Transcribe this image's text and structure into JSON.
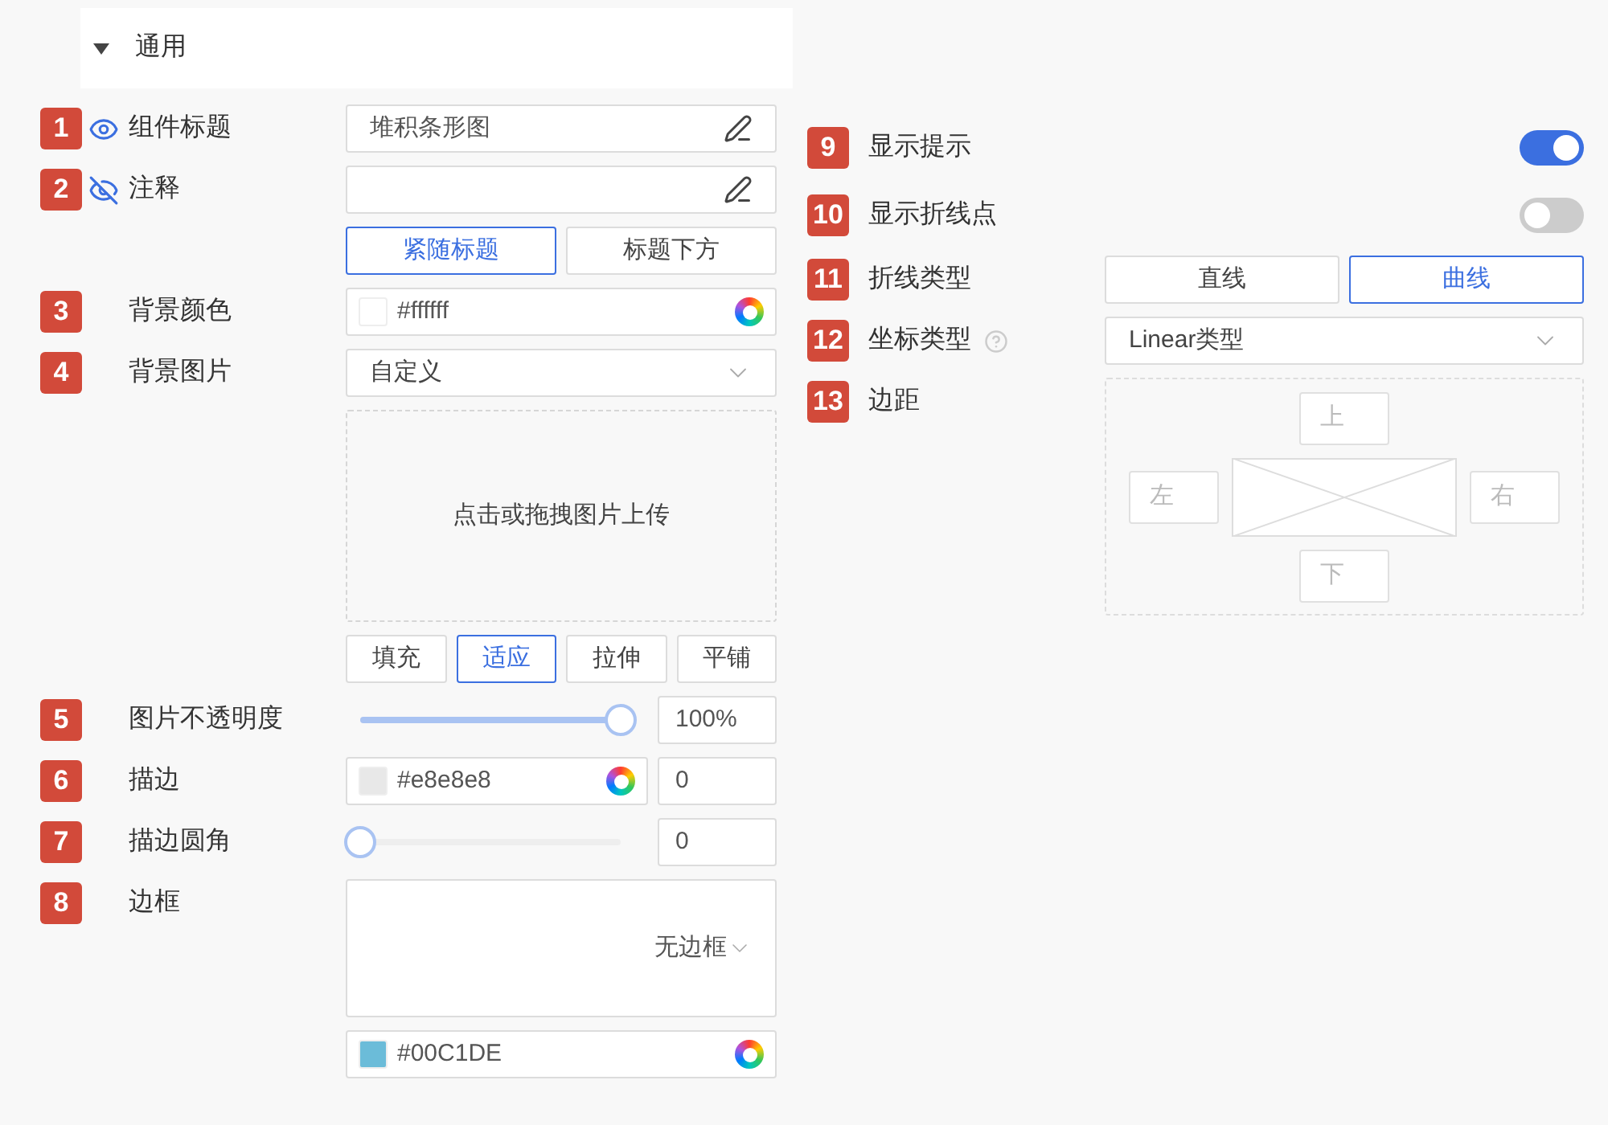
{
  "section": {
    "title": "通用",
    "expanded": true
  },
  "left": [
    {
      "kind": "text",
      "badge": "1",
      "visible": true,
      "label": "组件标题",
      "value": "堆积条形图"
    },
    {
      "kind": "text",
      "badge": "2",
      "visible": false,
      "label": "注释"
    },
    {
      "kind": "segmented",
      "options": [
        {
          "label": "紧随标题",
          "selected": true
        },
        {
          "label": "标题下方",
          "selected": false
        }
      ]
    },
    {
      "kind": "color",
      "badge": "3",
      "label": "背景颜色",
      "value": "#ffffff",
      "color": "#ffffff"
    },
    {
      "kind": "select",
      "badge": "4",
      "label": "背景图片",
      "value": "自定义"
    },
    {
      "kind": "upload",
      "text": "点击或拖拽图片上传"
    },
    {
      "kind": "segmented",
      "options": [
        {
          "label": "填充",
          "selected": false
        },
        {
          "label": "适应",
          "selected": true
        },
        {
          "label": "拉伸",
          "selected": false
        },
        {
          "label": "平铺",
          "selected": false
        }
      ]
    },
    {
      "kind": "slider",
      "badge": "5",
      "label": "图片不透明度",
      "level": 1,
      "value": "100%"
    },
    {
      "kind": "color-number",
      "badge": "6",
      "label": "描边",
      "value": "#e8e8e8",
      "color": "#e8e8e8",
      "number": "0"
    },
    {
      "kind": "slider",
      "badge": "7",
      "label": "描边圆角",
      "level": 0,
      "value": "0"
    },
    {
      "kind": "border",
      "badge": "8",
      "label": "边框",
      "value": "无边框"
    },
    {
      "kind": "color",
      "value": "#00C1DE",
      "color": "#6bbcd9"
    }
  ],
  "right": [
    {
      "kind": "switch",
      "badge": "9",
      "label": "显示提示",
      "on": true
    },
    {
      "kind": "switch",
      "badge": "10",
      "label": "显示折线点",
      "on": false
    },
    {
      "kind": "segmented",
      "badge": "11",
      "label": "折线类型",
      "options": [
        {
          "label": "直线",
          "selected": false
        },
        {
          "label": "曲线",
          "selected": true
        }
      ]
    },
    {
      "kind": "select",
      "badge": "12",
      "label": "坐标类型",
      "help": true,
      "value": "Linear类型"
    },
    {
      "kind": "margin",
      "badge": "13",
      "label": "边距",
      "top": "上",
      "left": "左",
      "right": "右",
      "bottom": "下"
    }
  ]
}
